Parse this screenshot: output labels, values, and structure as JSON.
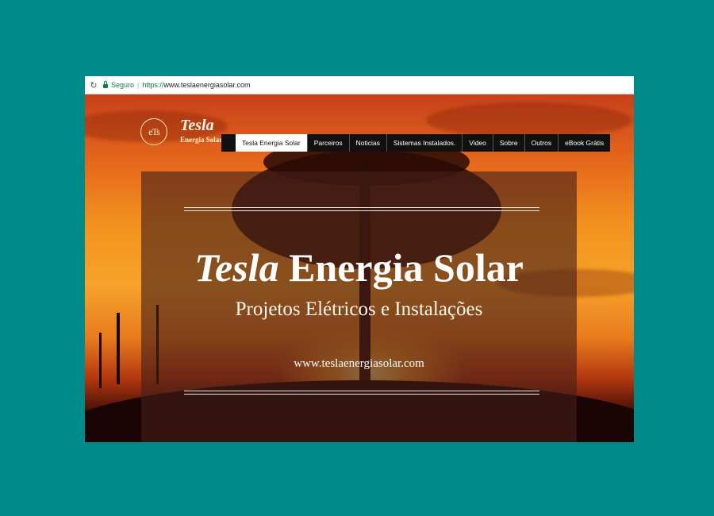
{
  "browser": {
    "secure_label": "Seguro",
    "url_protocol": "https://",
    "url_rest": "www.teslaenergiasolar.com"
  },
  "site": {
    "logo_mark": "eTs",
    "logo_title": "Tesla",
    "logo_subtitle": "Energia Solar",
    "nav": [
      {
        "label": "Tesla Energia Solar",
        "active": true
      },
      {
        "label": "Parceiros"
      },
      {
        "label": "Noticias"
      },
      {
        "label": "Sistemas Instalados."
      },
      {
        "label": "Video"
      },
      {
        "label": "Sobre"
      },
      {
        "label": "Outros"
      },
      {
        "label": "eBook Grátis"
      }
    ]
  },
  "hero": {
    "title_italic": "Tesla",
    "title_rest": "Energia Solar",
    "subtitle": "Projetos Elétricos e Instalações",
    "url": "www.teslaenergiasolar.com"
  },
  "colors": {
    "outer_background": "#008b8b",
    "secure_green": "#0b8043",
    "nav_background": "#111111"
  }
}
